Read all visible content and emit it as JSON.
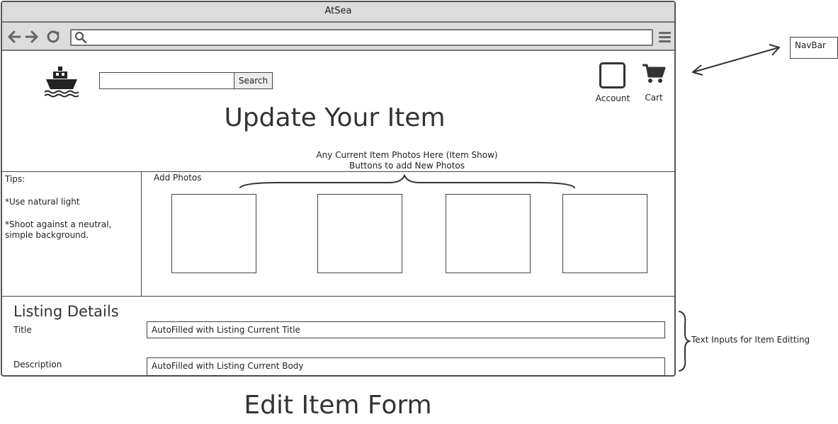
{
  "window": {
    "title": "AtSea"
  },
  "toolbar": {
    "back_icon": "arrow-left-icon",
    "forward_icon": "arrow-right-icon",
    "reload_icon": "reload-icon",
    "url_search_icon": "search-icon",
    "menu_icon": "hamburger-menu-icon"
  },
  "header": {
    "logo_icon": "ship-icon",
    "search_button": "Search",
    "account_label": "Account",
    "cart_label": "Cart",
    "page_title": "Update Your Item"
  },
  "photos": {
    "note_line1": "Any Current Item Photos Here (Item Show)",
    "note_line2": "Buttons to add New Photos",
    "add_photos_label": "Add Photos",
    "slot_count": 4
  },
  "tips": {
    "heading": "Tips:",
    "items": [
      "*Use natural light",
      "*Shoot against a neutral, simple background."
    ]
  },
  "listing": {
    "heading": "Listing Details",
    "title_label": "Title",
    "title_value": "AutoFilled with Listing Current Title",
    "description_label": "Description",
    "description_value": "AutoFilled with Listing Current Body"
  },
  "annotations": {
    "navbar": "NavBar",
    "text_inputs": "Text Inputs for Item Editting"
  },
  "caption": "Edit Item Form"
}
